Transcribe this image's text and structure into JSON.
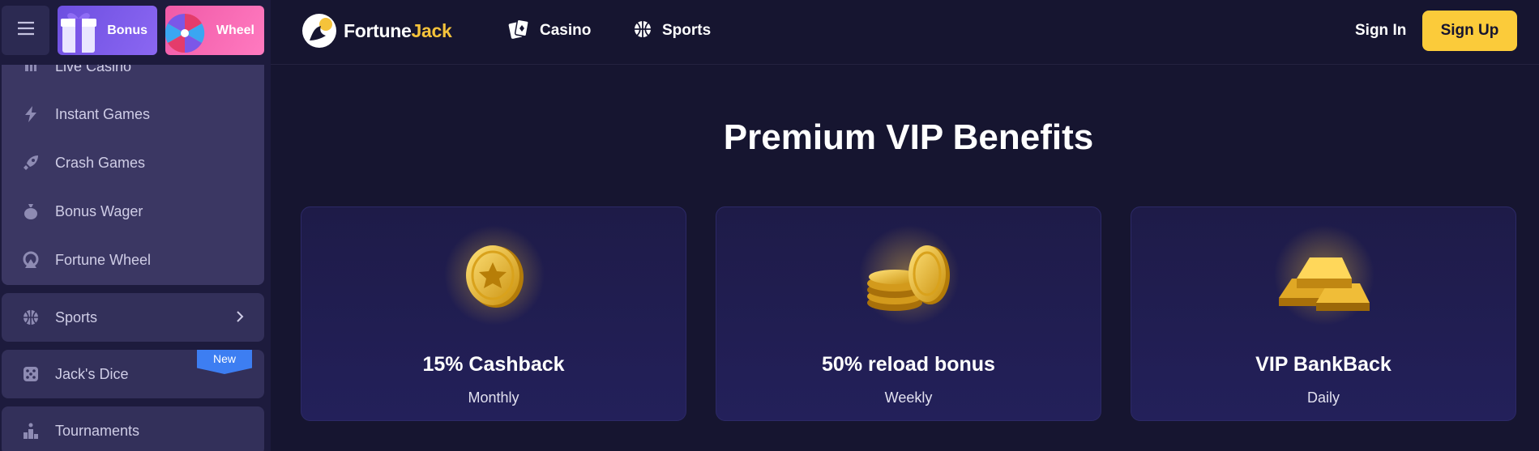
{
  "sidebar": {
    "promos": [
      {
        "label": "Bonus"
      },
      {
        "label": "Wheel"
      }
    ],
    "menu": [
      {
        "label": "Live Casino",
        "icon": "live-casino-icon"
      },
      {
        "label": "Instant Games",
        "icon": "lightning-icon"
      },
      {
        "label": "Crash Games",
        "icon": "rocket-icon"
      },
      {
        "label": "Bonus Wager",
        "icon": "money-bag-icon"
      },
      {
        "label": "Fortune Wheel",
        "icon": "wheel-icon"
      }
    ],
    "sports": {
      "label": "Sports",
      "icon": "basketball-icon"
    },
    "dice": {
      "label": "Jack's Dice",
      "icon": "dice-icon",
      "badge": "New"
    },
    "tournaments": {
      "label": "Tournaments",
      "icon": "podium-icon"
    }
  },
  "header": {
    "logo": {
      "part1": "Fortune",
      "part2": "Jack"
    },
    "nav": [
      {
        "label": "Casino",
        "icon": "cards-icon"
      },
      {
        "label": "Sports",
        "icon": "basketball-icon"
      }
    ],
    "sign_in": "Sign In",
    "sign_up": "Sign Up"
  },
  "main": {
    "title": "Premium VIP Benefits",
    "cards": [
      {
        "title": "15% Cashback",
        "subtitle": "Monthly",
        "icon": "gold-coin-icon"
      },
      {
        "title": "50% reload bonus",
        "subtitle": "Weekly",
        "icon": "coin-stack-icon"
      },
      {
        "title": "VIP BankBack",
        "subtitle": "Daily",
        "icon": "gold-bars-icon"
      }
    ]
  },
  "colors": {
    "background": "#161530",
    "accent": "#fbcb3a",
    "sidebar": "#1d1b3d",
    "badge": "#3d7ef2"
  }
}
